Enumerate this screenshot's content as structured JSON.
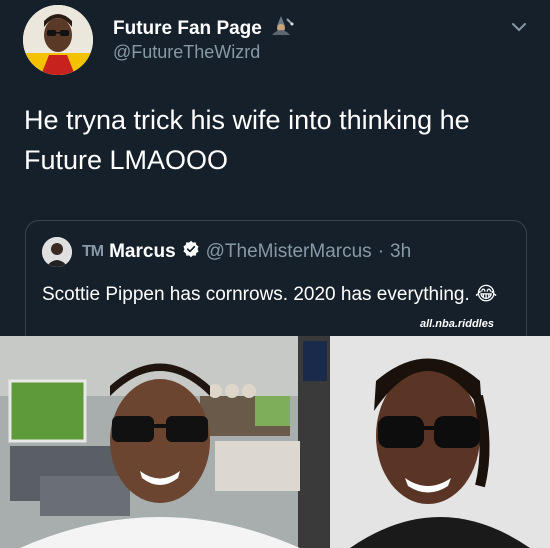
{
  "tweet": {
    "display_name": "Future Fan Page",
    "handle": "@FutureTheWizrd",
    "text": "He tryna trick his wife into thinking he Future LMAOOO",
    "badge_icon": "wizard-emoji-icon",
    "menu_icon": "chevron-down-icon"
  },
  "quoted_tweet": {
    "name_prefix": "TM",
    "name": "Marcus",
    "verified_icon": "verified-badge-icon",
    "handle": "@TheMisterMarcus",
    "separator": "·",
    "time": "3h",
    "text": "Scottie Pippen has cornrows. 2020 has everything. 😂"
  },
  "media": {
    "watermark": "all.nba.riddles",
    "left_photo": "man-in-sunglasses-living-room-photo",
    "right_photo": "man-in-sunglasses-portrait-photo"
  },
  "colors": {
    "background": "#15202b",
    "secondary_text": "#8899a6",
    "border": "#38444d",
    "verified": "#ffffff"
  }
}
